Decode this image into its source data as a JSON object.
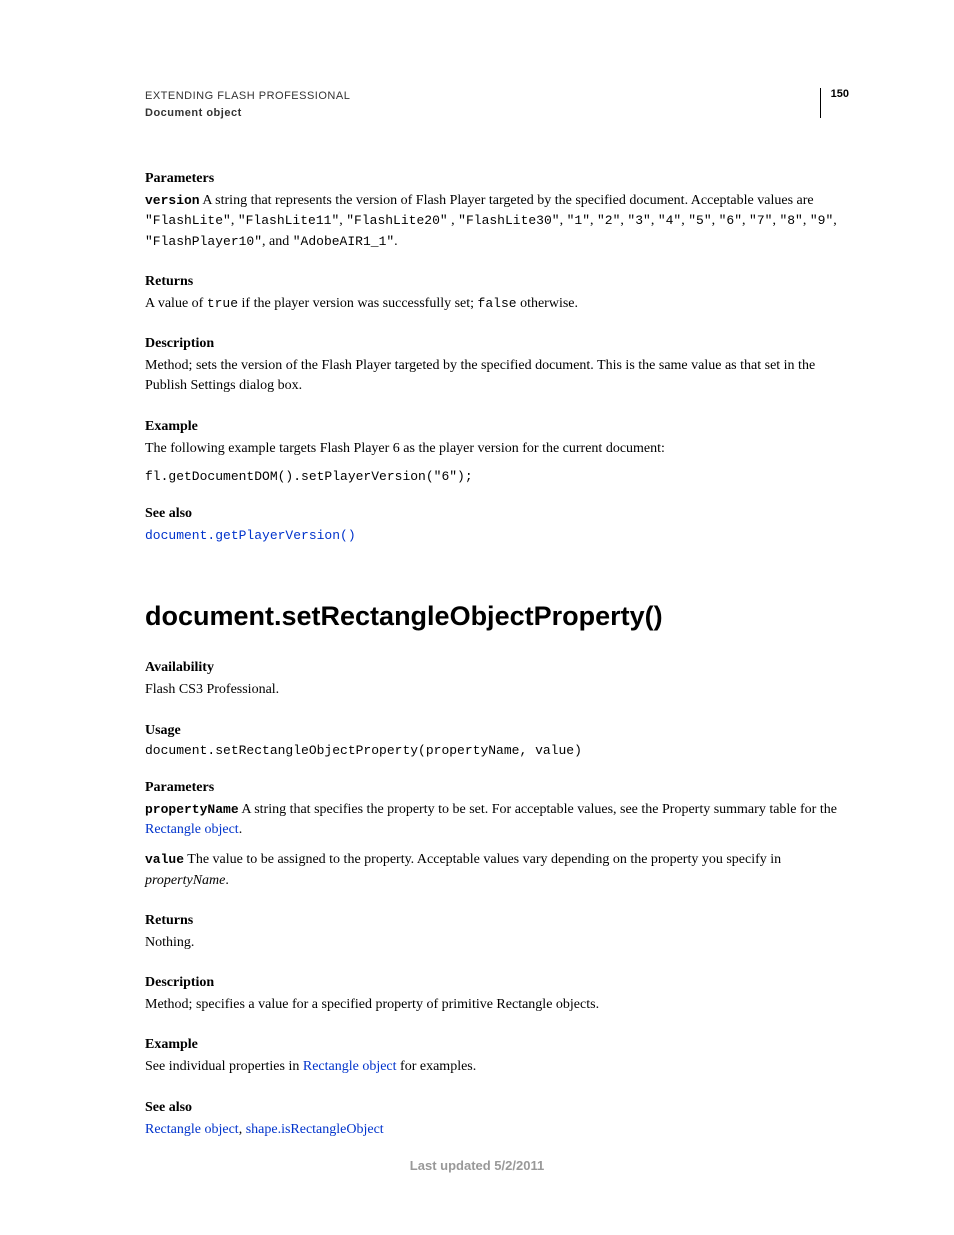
{
  "header": {
    "title": "EXTENDING FLASH PROFESSIONAL",
    "subtitle": "Document object",
    "page_number": "150"
  },
  "s1": {
    "parameters_h": "Parameters",
    "param_name": "version",
    "param_desc_1": "  A string that represents the version of Flash Player targeted by the specified document. Acceptable values are ",
    "vals_a": "\"FlashLite\"",
    "vals_b": "\"FlashLite11\"",
    "vals_c": "\"FlashLite20\"",
    "vals_d": "\"FlashLite30\"",
    "vals_e": "\"1\"",
    "vals_f": "\"2\"",
    "vals_g": "\"3\"",
    "vals_h": "\"4\"",
    "vals_i": "\"5\"",
    "vals_j": "\"6\"",
    "vals_k": "\"7\"",
    "vals_l": "\"8\"",
    "vals_m": "\"9\"",
    "vals_n": "\"FlashPlayer10\"",
    "vals_and": ", and ",
    "vals_o": "\"AdobeAIR1_1\"",
    "returns_h": "Returns",
    "returns_1": "A value of ",
    "returns_true": "true",
    "returns_2": " if the player version was successfully set; ",
    "returns_false": "false",
    "returns_3": " otherwise.",
    "desc_h": "Description",
    "desc_body": "Method; sets the version of the Flash Player targeted by the specified document. This is the same value as that set in the Publish Settings dialog box.",
    "example_h": "Example",
    "example_body": "The following example targets Flash Player 6 as the player version for the current document:",
    "example_code": "fl.getDocumentDOM().setPlayerVersion(\"6\");",
    "seealso_h": "See also",
    "seealso_link": "document.getPlayerVersion()"
  },
  "s2": {
    "heading": "document.setRectangleObjectProperty()",
    "avail_h": "Availability",
    "avail_body": "Flash CS3 Professional.",
    "usage_h": "Usage",
    "usage_code": "document.setRectangleObjectProperty(propertyName, value)",
    "params_h": "Parameters",
    "p1_name": "propertyName",
    "p1_desc_a": "  A string that specifies the property to be set. For acceptable values, see the Property summary table for the ",
    "p1_link": "Rectangle object",
    "p2_name": "value",
    "p2_desc_a": "  The value to be assigned to the property. Acceptable values vary depending on the property you specify in ",
    "p2_desc_b": "propertyName",
    "returns_h": "Returns",
    "returns_body": "Nothing.",
    "desc_h": "Description",
    "desc_body": "Method; specifies a value for a specified property of primitive Rectangle objects.",
    "example_h": "Example",
    "example_a": "See individual properties in ",
    "example_link": "Rectangle object",
    "example_b": " for examples.",
    "seealso_h": "See also",
    "seealso_link1": "Rectangle object",
    "seealso_link2": "shape.isRectangleObject"
  },
  "footer": "Last updated 5/2/2011"
}
